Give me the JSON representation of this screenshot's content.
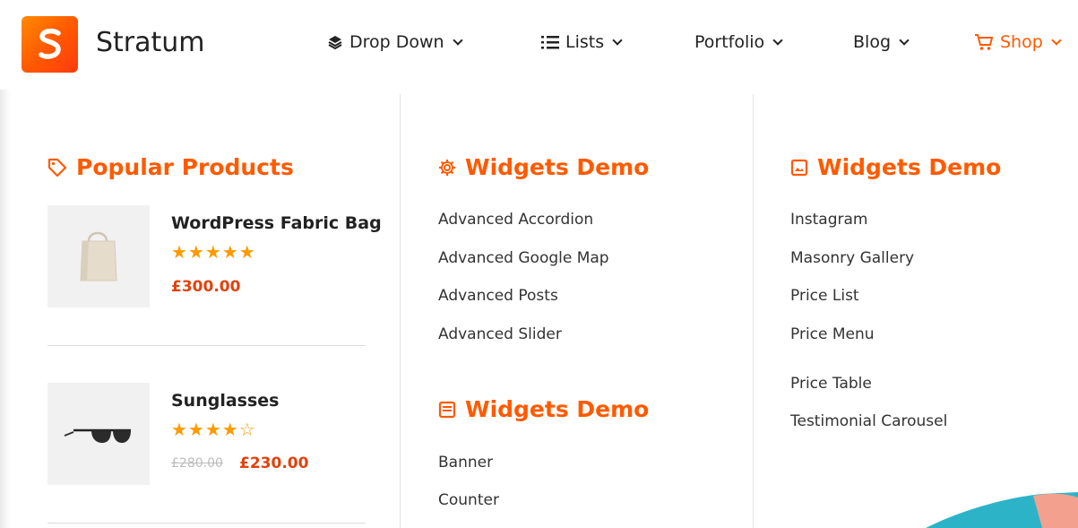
{
  "brand": {
    "name": "Stratum",
    "logo_letter": "S",
    "accent": "#ff5a00"
  },
  "nav": [
    {
      "label": "Drop Down",
      "icon": "layers-icon",
      "active": false
    },
    {
      "label": "Lists",
      "icon": "list-icon",
      "active": false
    },
    {
      "label": "Portfolio",
      "icon": "",
      "active": false
    },
    {
      "label": "Blog",
      "icon": "",
      "active": false
    },
    {
      "label": "Shop",
      "icon": "cart-icon",
      "active": true
    }
  ],
  "popular": {
    "title": "Popular Products",
    "icon": "tag-icon",
    "products": [
      {
        "name": "WordPress Fabric Bag",
        "rating": 5,
        "stars": "★★★★★",
        "old_price": "",
        "price": "£300.00",
        "image": "fabric-bag"
      },
      {
        "name": "Sunglasses",
        "rating": 4,
        "stars": "★★★★☆",
        "old_price": "£280.00",
        "price": "£230.00",
        "image": "sunglasses"
      }
    ]
  },
  "widgets1": {
    "title": "Widgets Demo",
    "icon": "gear-icon",
    "links": [
      "Advanced Accordion",
      "Advanced Google Map",
      "Advanced Posts",
      "Advanced Slider"
    ]
  },
  "widgets2": {
    "title": "Widgets Demo",
    "icon": "document-icon",
    "links": [
      "Banner",
      "Counter"
    ]
  },
  "widgets3": {
    "title": "Widgets Demo",
    "icon": "image-icon",
    "links": [
      "Instagram",
      "Masonry Gallery",
      "Price List",
      "Price Menu",
      "Price Table",
      "Testimonial Carousel"
    ]
  }
}
